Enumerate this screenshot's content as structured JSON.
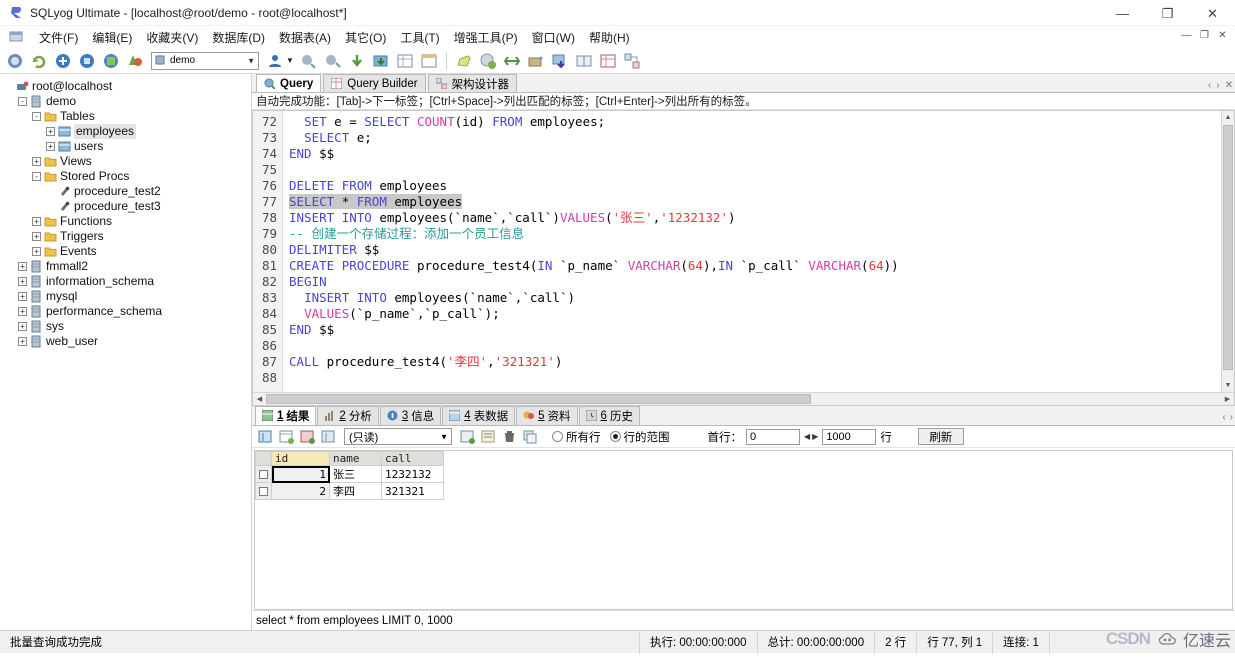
{
  "window": {
    "title": "SQLyog Ultimate - [localhost@root/demo - root@localhost*]",
    "app_icon": "sqlyog-icon",
    "minimize": "—",
    "maximize": "❐",
    "close": "✕",
    "mdi_minimize": "—",
    "mdi_restore": "❐",
    "mdi_close": "✕"
  },
  "menubar": {
    "items": [
      {
        "label": "文件(F)",
        "name": "menu-file"
      },
      {
        "label": "编辑(E)",
        "name": "menu-edit"
      },
      {
        "label": "收藏夹(V)",
        "name": "menu-favorites"
      },
      {
        "label": "数据库(D)",
        "name": "menu-database"
      },
      {
        "label": "数据表(A)",
        "name": "menu-table"
      },
      {
        "label": "其它(O)",
        "name": "menu-other"
      },
      {
        "label": "工具(T)",
        "name": "menu-tools"
      },
      {
        "label": "增强工具(P)",
        "name": "menu-powertools"
      },
      {
        "label": "窗口(W)",
        "name": "menu-window"
      },
      {
        "label": "帮助(H)",
        "name": "menu-help"
      }
    ]
  },
  "toolbar": {
    "database_value": "demo",
    "dropdown_arrow": "▼"
  },
  "sidebar": {
    "root": "root@localhost",
    "nodes": [
      {
        "label": "root@localhost",
        "indent": 0,
        "expander": "",
        "icon": "host-icon"
      },
      {
        "label": "demo",
        "indent": 1,
        "expander": "-",
        "icon": "database-icon"
      },
      {
        "label": "Tables",
        "indent": 2,
        "expander": "-",
        "icon": "folder-icon"
      },
      {
        "label": "employees",
        "indent": 3,
        "expander": "+",
        "icon": "table-icon",
        "selected": true
      },
      {
        "label": "users",
        "indent": 3,
        "expander": "+",
        "icon": "table-icon"
      },
      {
        "label": "Views",
        "indent": 2,
        "expander": "+",
        "icon": "folder-icon"
      },
      {
        "label": "Stored Procs",
        "indent": 2,
        "expander": "-",
        "icon": "folder-icon"
      },
      {
        "label": "procedure_test2",
        "indent": 3,
        "expander": "",
        "icon": "procedure-icon"
      },
      {
        "label": "procedure_test3",
        "indent": 3,
        "expander": "",
        "icon": "procedure-icon"
      },
      {
        "label": "Functions",
        "indent": 2,
        "expander": "+",
        "icon": "folder-icon"
      },
      {
        "label": "Triggers",
        "indent": 2,
        "expander": "+",
        "icon": "folder-icon"
      },
      {
        "label": "Events",
        "indent": 2,
        "expander": "+",
        "icon": "folder-icon"
      },
      {
        "label": "fmmall2",
        "indent": 1,
        "expander": "+",
        "icon": "database-icon"
      },
      {
        "label": "information_schema",
        "indent": 1,
        "expander": "+",
        "icon": "database-icon"
      },
      {
        "label": "mysql",
        "indent": 1,
        "expander": "+",
        "icon": "database-icon"
      },
      {
        "label": "performance_schema",
        "indent": 1,
        "expander": "+",
        "icon": "database-icon"
      },
      {
        "label": "sys",
        "indent": 1,
        "expander": "+",
        "icon": "database-icon"
      },
      {
        "label": "web_user",
        "indent": 1,
        "expander": "+",
        "icon": "database-icon"
      }
    ]
  },
  "query_tabs": {
    "tabs": [
      {
        "label": "Query",
        "active": true,
        "icon": "query-icon"
      },
      {
        "label": "Query Builder",
        "active": false,
        "icon": "query-builder-icon"
      },
      {
        "label": "架构设计器",
        "active": false,
        "icon": "schema-designer-icon"
      }
    ],
    "nav_prev": "‹",
    "nav_next": "›",
    "close": "✕"
  },
  "hint": "自动完成功能：[Tab]->下一标签；[Ctrl+Space]->列出匹配的标签；[Ctrl+Enter]->列出所有的标签。",
  "editor": {
    "first_line": 72,
    "lines": [
      {
        "n": 72,
        "tokens": [
          {
            "t": "  ",
            "c": "pln"
          },
          {
            "t": "SET",
            "c": "kw"
          },
          {
            "t": " e ",
            "c": "pln"
          },
          {
            "t": "=",
            "c": "op"
          },
          {
            "t": " ",
            "c": "pln"
          },
          {
            "t": "SELECT",
            "c": "kw"
          },
          {
            "t": " ",
            "c": "pln"
          },
          {
            "t": "COUNT",
            "c": "fn"
          },
          {
            "t": "(id) ",
            "c": "pln"
          },
          {
            "t": "FROM",
            "c": "kw"
          },
          {
            "t": " employees;",
            "c": "pln"
          }
        ]
      },
      {
        "n": 73,
        "tokens": [
          {
            "t": "  ",
            "c": "pln"
          },
          {
            "t": "SELECT",
            "c": "kw"
          },
          {
            "t": " e;",
            "c": "pln"
          }
        ]
      },
      {
        "n": 74,
        "tokens": [
          {
            "t": "END",
            "c": "kw"
          },
          {
            "t": " $$",
            "c": "pln"
          }
        ]
      },
      {
        "n": 75,
        "tokens": []
      },
      {
        "n": 76,
        "tokens": [
          {
            "t": "DELETE",
            "c": "kw"
          },
          {
            "t": " ",
            "c": "pln"
          },
          {
            "t": "FROM",
            "c": "kw"
          },
          {
            "t": " employees",
            "c": "pln"
          }
        ]
      },
      {
        "n": 77,
        "selected": true,
        "tokens": [
          {
            "t": "SELECT",
            "c": "kw"
          },
          {
            "t": " ",
            "c": "pln"
          },
          {
            "t": "*",
            "c": "op"
          },
          {
            "t": " ",
            "c": "pln"
          },
          {
            "t": "FROM",
            "c": "kw"
          },
          {
            "t": " employees",
            "c": "pln"
          }
        ]
      },
      {
        "n": 78,
        "tokens": [
          {
            "t": "INSERT",
            "c": "kw"
          },
          {
            "t": " ",
            "c": "pln"
          },
          {
            "t": "INTO",
            "c": "kw"
          },
          {
            "t": " employees(`name`,`call`)",
            "c": "pln"
          },
          {
            "t": "VALUES",
            "c": "fn"
          },
          {
            "t": "(",
            "c": "pln"
          },
          {
            "t": "'张三'",
            "c": "str"
          },
          {
            "t": ",",
            "c": "pln"
          },
          {
            "t": "'1232132'",
            "c": "str"
          },
          {
            "t": ")",
            "c": "pln"
          }
        ]
      },
      {
        "n": 79,
        "tokens": [
          {
            "t": "-- 创建一个存储过程：添加一个员工信息",
            "c": "com"
          }
        ]
      },
      {
        "n": 80,
        "tokens": [
          {
            "t": "DELIMITER",
            "c": "kw"
          },
          {
            "t": " $$",
            "c": "pln"
          }
        ]
      },
      {
        "n": 81,
        "tokens": [
          {
            "t": "CREATE",
            "c": "kw"
          },
          {
            "t": " ",
            "c": "pln"
          },
          {
            "t": "PROCEDURE",
            "c": "kw"
          },
          {
            "t": " procedure_test4(",
            "c": "pln"
          },
          {
            "t": "IN",
            "c": "kw"
          },
          {
            "t": " `p_name` ",
            "c": "pln"
          },
          {
            "t": "VARCHAR",
            "c": "fn"
          },
          {
            "t": "(",
            "c": "pln"
          },
          {
            "t": "64",
            "c": "str"
          },
          {
            "t": "),",
            "c": "pln"
          },
          {
            "t": "IN",
            "c": "kw"
          },
          {
            "t": " `p_call` ",
            "c": "pln"
          },
          {
            "t": "VARCHAR",
            "c": "fn"
          },
          {
            "t": "(",
            "c": "pln"
          },
          {
            "t": "64",
            "c": "str"
          },
          {
            "t": "))",
            "c": "pln"
          }
        ]
      },
      {
        "n": 82,
        "tokens": [
          {
            "t": "BEGIN",
            "c": "kw"
          }
        ]
      },
      {
        "n": 83,
        "tokens": [
          {
            "t": "  ",
            "c": "pln"
          },
          {
            "t": "INSERT",
            "c": "kw"
          },
          {
            "t": " ",
            "c": "pln"
          },
          {
            "t": "INTO",
            "c": "kw"
          },
          {
            "t": " employees(`name`,`call`)",
            "c": "pln"
          }
        ]
      },
      {
        "n": 84,
        "tokens": [
          {
            "t": "  ",
            "c": "pln"
          },
          {
            "t": "VALUES",
            "c": "fn"
          },
          {
            "t": "(`p_name`,`p_call`);",
            "c": "pln"
          }
        ]
      },
      {
        "n": 85,
        "tokens": [
          {
            "t": "END",
            "c": "kw"
          },
          {
            "t": " $$",
            "c": "pln"
          }
        ]
      },
      {
        "n": 86,
        "tokens": []
      },
      {
        "n": 87,
        "tokens": [
          {
            "t": "CALL",
            "c": "kw"
          },
          {
            "t": " procedure_test4(",
            "c": "pln"
          },
          {
            "t": "'李四'",
            "c": "str"
          },
          {
            "t": ",",
            "c": "pln"
          },
          {
            "t": "'321321'",
            "c": "str"
          },
          {
            "t": ")",
            "c": "pln"
          }
        ]
      },
      {
        "n": 88,
        "tokens": []
      }
    ],
    "scroll_up": "▲",
    "scroll_down": "▼",
    "scroll_left": "◀",
    "scroll_right": "▶"
  },
  "result_tabs": {
    "tabs": [
      {
        "num": "1",
        "label": "结果",
        "active": true,
        "icon": "result-grid-icon"
      },
      {
        "num": "2",
        "label": "分析",
        "active": false,
        "icon": "profile-icon"
      },
      {
        "num": "3",
        "label": "信息",
        "active": false,
        "icon": "messages-icon"
      },
      {
        "num": "4",
        "label": "表数据",
        "active": false,
        "icon": "table-data-icon"
      },
      {
        "num": "5",
        "label": "资料",
        "active": false,
        "icon": "info-icon"
      },
      {
        "num": "6",
        "label": "历史",
        "active": false,
        "icon": "history-icon"
      }
    ],
    "nav_prev": "‹",
    "nav_next": "›"
  },
  "result_toolbar": {
    "mode_value": "(只读)",
    "dropdown_arrow": "▼",
    "radio_all_rows": "所有行",
    "radio_row_range": "行的范围",
    "selected_radio": "行的范围",
    "first_row_label": "首行：",
    "first_row_value": "0",
    "limit_value": "1000",
    "rows_unit": "行",
    "refresh_label": "刷新",
    "spin_prev": "◀",
    "spin_next": "▶"
  },
  "grid": {
    "columns": [
      "id",
      "name",
      "call"
    ],
    "primary_key_column": "id",
    "rows": [
      {
        "id": "1",
        "name": "张三",
        "call": "1232132",
        "current": true
      },
      {
        "id": "2",
        "name": "李四",
        "call": "321321",
        "current": false
      }
    ]
  },
  "query_status": "select * from employees  LIMIT 0, 1000",
  "statusbar": {
    "message": "批量查询成功完成",
    "exec_time": "执行: 00:00:00:000",
    "total_time": "总计: 00:00:00:000",
    "row_count": "2 行",
    "cursor_pos": "行 77, 列 1",
    "connection": "连接: 1"
  },
  "watermark": {
    "csdn": "CSDN",
    "yisuyun": "亿速云"
  },
  "colors": {
    "keyword": "#4646d0",
    "function": "#d23fa0",
    "string": "#e0383e",
    "comment": "#2a9a9a",
    "selection": "#c8c8c8",
    "pk_header": "#f5e9b8"
  }
}
